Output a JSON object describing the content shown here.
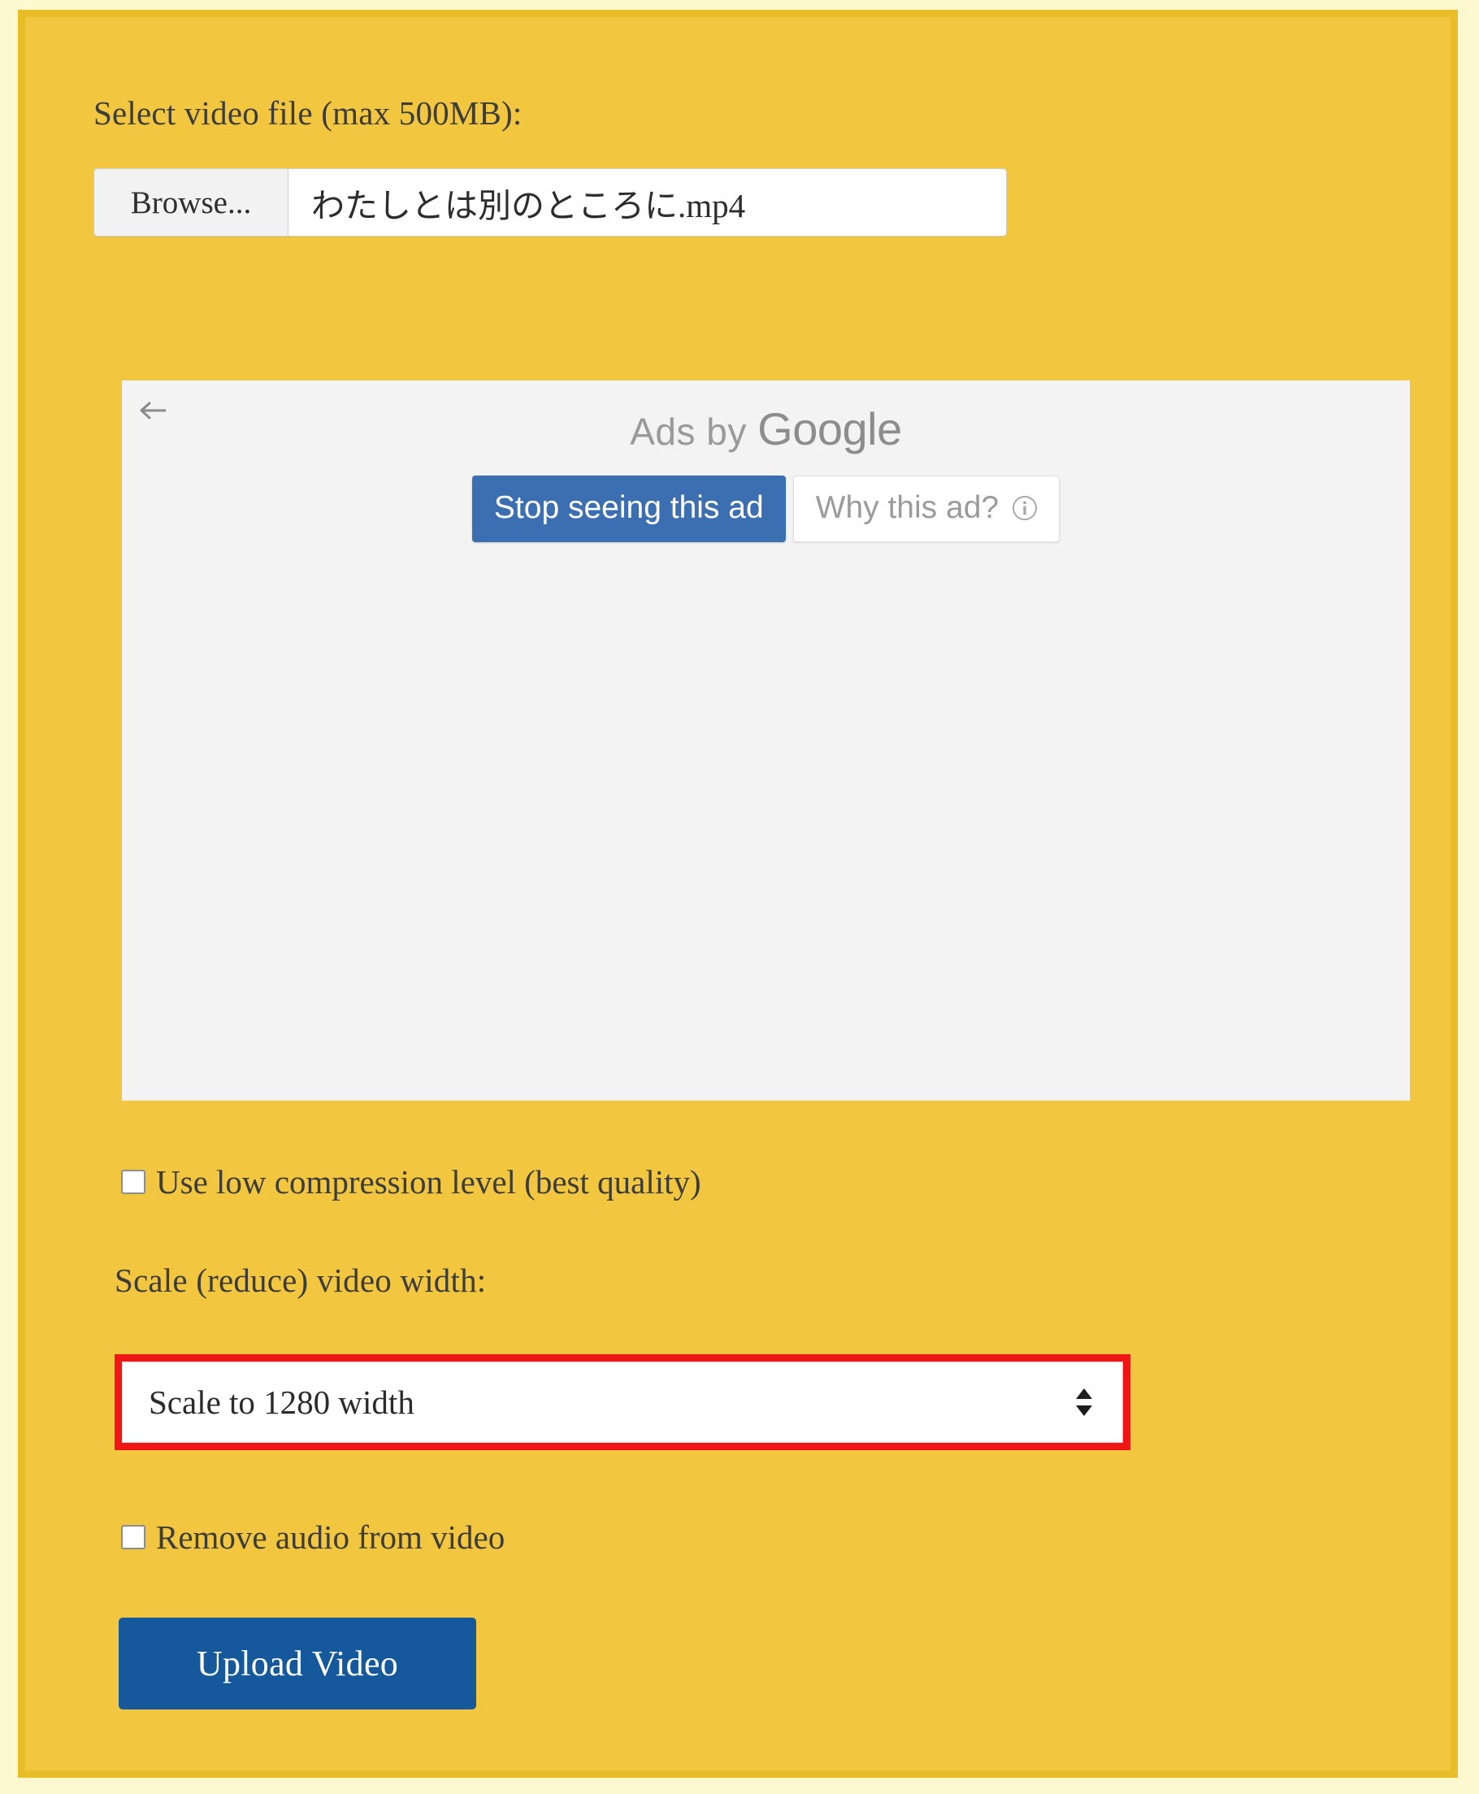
{
  "form": {
    "file_label": "Select video file (max 500MB):",
    "browse_button": "Browse...",
    "file_name": "わたしとは別のところに.mp4",
    "low_compression_label": "Use low compression level (best quality)",
    "scale_label": "Scale (reduce) video width:",
    "scale_selected": "Scale to 1280 width",
    "remove_audio_label": "Remove audio from video",
    "upload_button": "Upload Video"
  },
  "ad": {
    "ads_by": "Ads by",
    "brand": "Google",
    "stop_button": "Stop seeing this ad",
    "why_button": "Why this ad?"
  },
  "colors": {
    "panel_background": "#f2c63f",
    "panel_border": "#e8bd28",
    "page_background": "#fdf8cf",
    "ad_panel_background": "#f3f3f3",
    "stop_ad_blue": "#3c6fb1",
    "upload_blue": "#15599c",
    "highlight_red": "#f11616",
    "text": "#3c3c3c"
  }
}
